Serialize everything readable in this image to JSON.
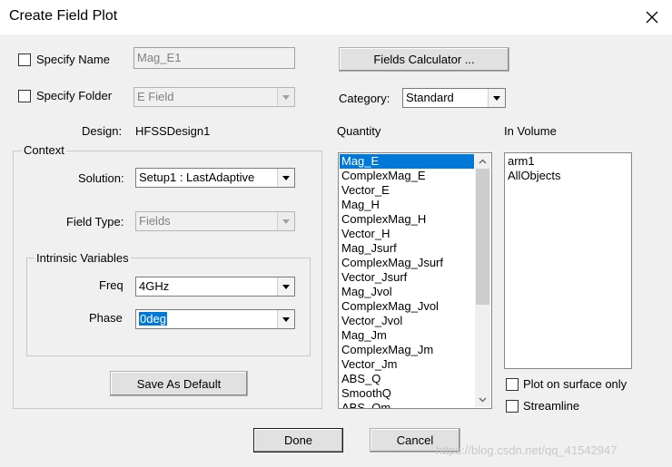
{
  "window": {
    "title": "Create Field Plot",
    "close_icon": "close-icon"
  },
  "specify_name": {
    "label": "Specify Name",
    "checked": false,
    "value": "Mag_E1"
  },
  "specify_folder": {
    "label": "Specify Folder",
    "checked": false,
    "value": "E Field"
  },
  "fields_calculator_label": "Fields Calculator ...",
  "category": {
    "label": "Category:",
    "value": "Standard"
  },
  "design": {
    "label": "Design:",
    "value": "HFSSDesign1"
  },
  "context": {
    "label": "Context",
    "solution": {
      "label": "Solution:",
      "value": "Setup1 : LastAdaptive"
    },
    "field_type": {
      "label": "Field Type:",
      "value": "Fields"
    },
    "intrinsic": {
      "label": "Intrinsic Variables",
      "freq": {
        "label": "Freq",
        "value": "4GHz"
      },
      "phase": {
        "label": "Phase",
        "value": "0deg"
      }
    }
  },
  "save_default_label": "Save As Default",
  "quantity": {
    "label": "Quantity",
    "selected": "Mag_E",
    "items": [
      "Mag_E",
      "ComplexMag_E",
      "Vector_E",
      "Mag_H",
      "ComplexMag_H",
      "Vector_H",
      "Mag_Jsurf",
      "ComplexMag_Jsurf",
      "Vector_Jsurf",
      "Mag_Jvol",
      "ComplexMag_Jvol",
      "Vector_Jvol",
      "Mag_Jm",
      "ComplexMag_Jm",
      "Vector_Jm",
      "ABS_Q",
      "SmoothQ",
      "ABS_Qm"
    ]
  },
  "in_volume": {
    "label": "In Volume",
    "items": [
      "arm1",
      "AllObjects"
    ]
  },
  "plot_on_surface": {
    "label": "Plot on surface only",
    "checked": false
  },
  "streamline": {
    "label": "Streamline",
    "checked": false
  },
  "done_label": "Done",
  "cancel_label": "Cancel",
  "watermark": "https://blog.csdn.net/qq_41542947",
  "colors": {
    "accent": "#0078d7",
    "background": "#f0f0f0"
  }
}
